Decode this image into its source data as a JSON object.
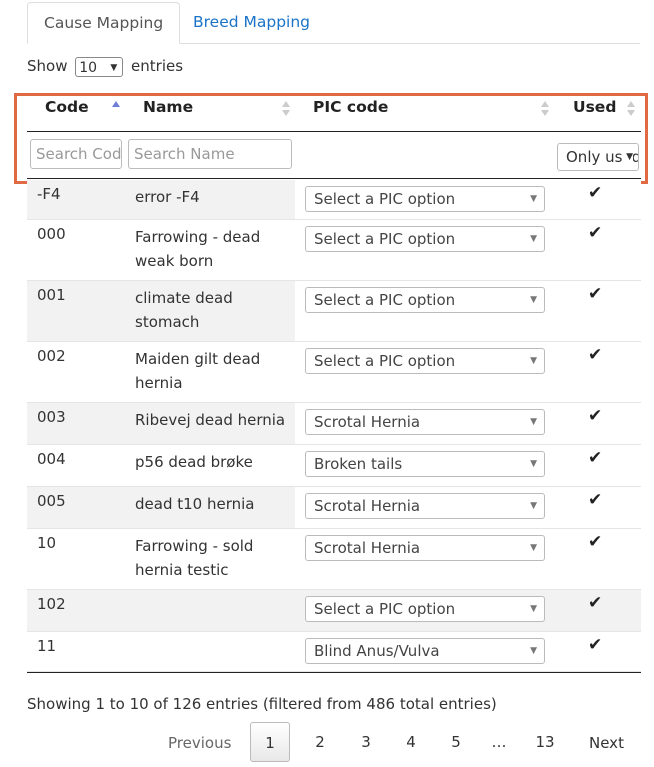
{
  "tabs": [
    {
      "label": "Cause Mapping",
      "active": true
    },
    {
      "label": "Breed Mapping",
      "active": false
    }
  ],
  "length_control": {
    "prefix": "Show",
    "value": "10",
    "suffix": "entries"
  },
  "columns": [
    {
      "label": "Code",
      "sort": "asc"
    },
    {
      "label": "Name",
      "sort": "none"
    },
    {
      "label": "PIC code",
      "sort": "none"
    },
    {
      "label": "Used",
      "sort": "none"
    }
  ],
  "filters": {
    "code_placeholder": "Search Code",
    "name_placeholder": "Search Name",
    "used_value": "Only used"
  },
  "rows": [
    {
      "code": "-F4",
      "name": "error -F4",
      "pic": "Select a PIC option",
      "used": "✔"
    },
    {
      "code": "000",
      "name": "Farrowing - dead weak born",
      "pic": "Select a PIC option",
      "used": "✔"
    },
    {
      "code": "001",
      "name": "climate dead stomach",
      "pic": "Select a PIC option",
      "used": "✔"
    },
    {
      "code": "002",
      "name": "Maiden gilt dead hernia",
      "pic": "Select a PIC option",
      "used": "✔"
    },
    {
      "code": "003",
      "name": "Ribevej dead hernia",
      "pic": "Scrotal Hernia",
      "used": "✔"
    },
    {
      "code": "004",
      "name": "p56 dead brøke",
      "pic": "Broken tails",
      "used": "✔"
    },
    {
      "code": "005",
      "name": "dead t10 hernia",
      "pic": "Scrotal Hernia",
      "used": "✔"
    },
    {
      "code": "10",
      "name": "Farrowing - sold hernia testic",
      "pic": "Scrotal Hernia",
      "used": "✔"
    },
    {
      "code": "102",
      "name": "",
      "pic": "Select a PIC option",
      "used": "✔"
    },
    {
      "code": "11",
      "name": "",
      "pic": "Blind Anus/Vulva",
      "used": "✔"
    }
  ],
  "info": "Showing 1 to 10 of 126 entries (filtered from 486 total entries)",
  "pagination": {
    "previous": "Previous",
    "pages": [
      "1",
      "2",
      "3",
      "4",
      "5",
      "…",
      "13"
    ],
    "current": "1",
    "next": "Next"
  },
  "colors": {
    "link": "#1a73c8",
    "highlight_border": "#e06a44",
    "sort_active": "#6f7fd8"
  }
}
